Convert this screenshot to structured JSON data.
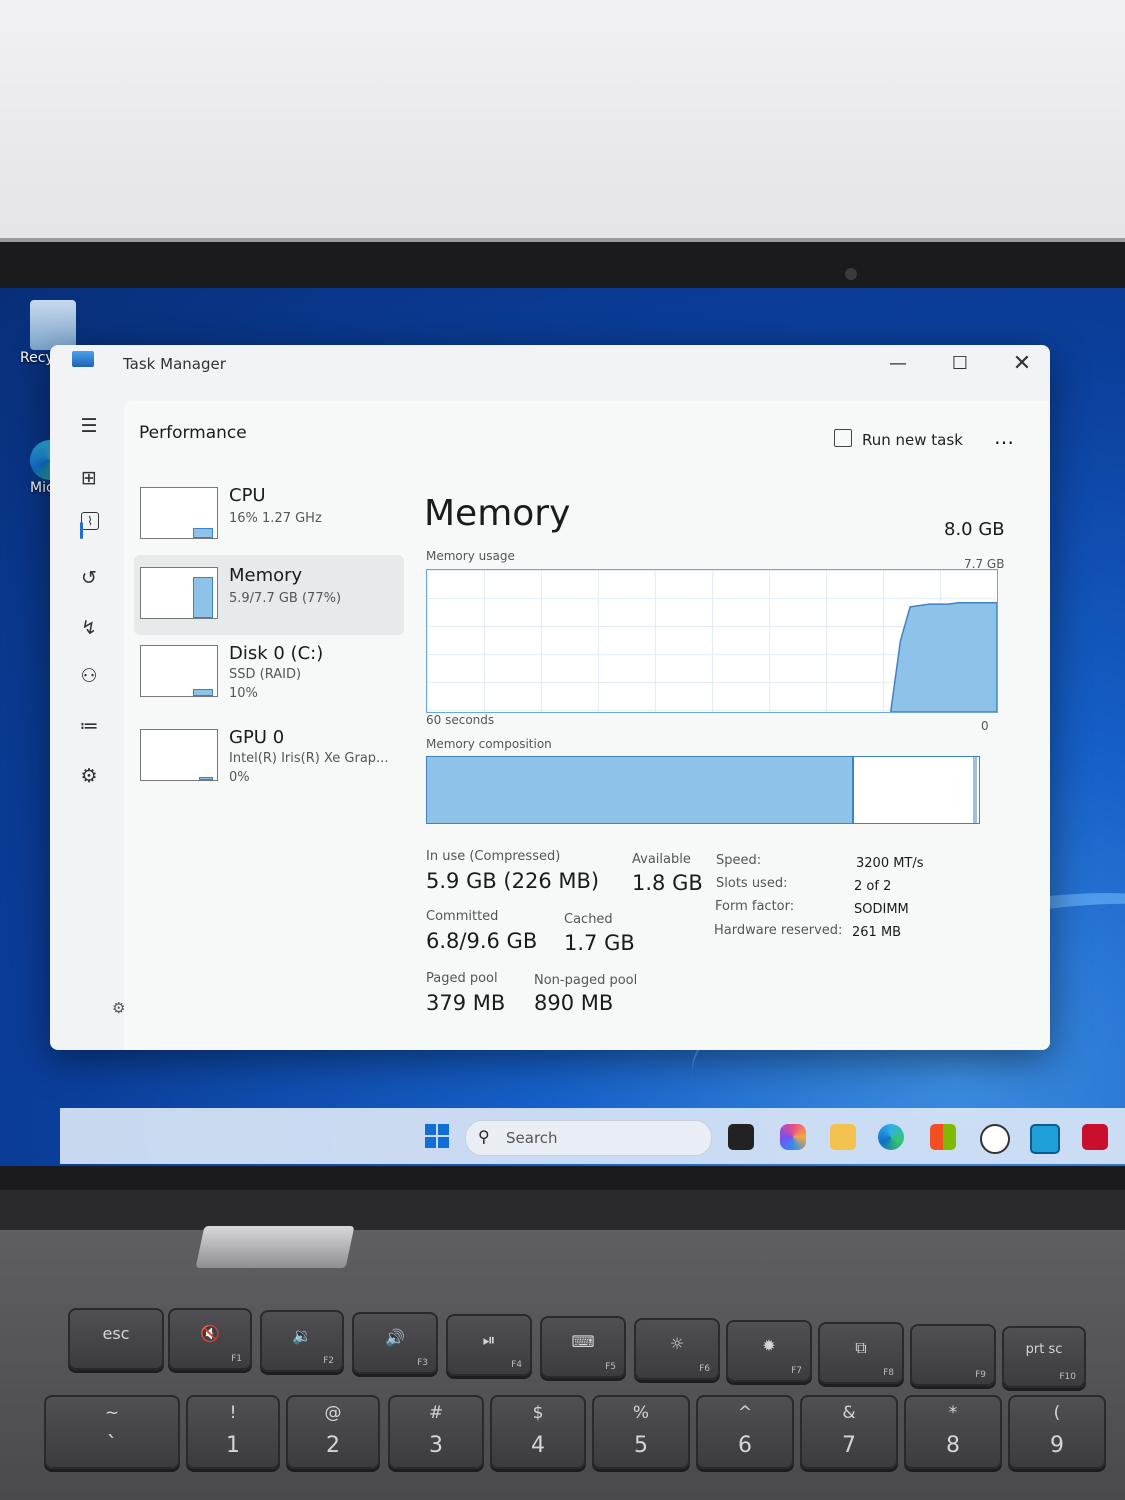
{
  "desktop": {
    "recycle_label": "Recy",
    "edge_label": "Mic E"
  },
  "window": {
    "title": "Task Manager",
    "minimize_glyph": "—",
    "maximize_glyph": "☐",
    "close_glyph": "✕"
  },
  "nav": {
    "menu_glyph": "☰",
    "processes_glyph": "⊞",
    "performance_glyph": "⌇",
    "history_glyph": "↺",
    "startup_glyph": "↯",
    "users_glyph": "⚇",
    "details_glyph": "≔",
    "services_glyph": "⚙",
    "settings_glyph": "⚙"
  },
  "header": {
    "section_title": "Performance",
    "run_new_task": "Run new task",
    "more_glyph": "…"
  },
  "perf_list": [
    {
      "name": "CPU",
      "line1": "16%  1.27 GHz",
      "line2": "",
      "graph_level": 0.16
    },
    {
      "name": "Memory",
      "line1": "5.9/7.7 GB (77%)",
      "line2": "",
      "graph_level": 0.77
    },
    {
      "name": "Disk 0 (C:)",
      "line1": "SSD (RAID)",
      "line2": "10%",
      "graph_level": 0.1
    },
    {
      "name": "GPU 0",
      "line1": "Intel(R) Iris(R) Xe Grap...",
      "line2": "0%",
      "graph_level": 0.0
    }
  ],
  "memory": {
    "heading": "Memory",
    "total": "8.0 GB",
    "usage_label": "Memory usage",
    "usage_max": "7.7 GB",
    "time_span": "60 seconds",
    "usage_min": "0",
    "composition_label": "Memory composition",
    "in_use_fraction": 0.77,
    "usage_history": [
      0,
      0,
      0,
      0,
      0,
      0,
      0,
      0,
      0,
      0,
      0,
      0,
      0,
      0,
      0,
      0,
      0,
      0,
      0,
      0,
      0,
      0,
      0,
      0,
      0,
      0,
      0,
      0,
      0,
      0,
      0,
      0,
      0,
      0,
      0,
      0,
      0,
      0,
      0,
      0,
      0,
      0,
      0,
      0,
      0,
      0,
      0,
      0,
      0,
      0.5,
      0.74,
      0.75,
      0.76,
      0.76,
      0.76,
      0.77,
      0.77,
      0.77,
      0.77,
      0.77
    ],
    "stats": {
      "in_use_label": "In use (Compressed)",
      "in_use_value": "5.9 GB (226 MB)",
      "available_label": "Available",
      "available_value": "1.8 GB",
      "committed_label": "Committed",
      "committed_value": "6.8/9.6 GB",
      "cached_label": "Cached",
      "cached_value": "1.7 GB",
      "paged_label": "Paged pool",
      "paged_value": "379 MB",
      "nonpaged_label": "Non-paged pool",
      "nonpaged_value": "890 MB"
    },
    "specs": [
      {
        "label": "Speed:",
        "value": "3200 MT/s"
      },
      {
        "label": "Slots used:",
        "value": "2 of 2"
      },
      {
        "label": "Form factor:",
        "value": "SODIMM"
      },
      {
        "label": "Hardware reserved:",
        "value": "261 MB"
      }
    ]
  },
  "taskbar": {
    "search_placeholder": "Search",
    "search_glyph": "⚲"
  },
  "keyboard": {
    "fn_row": [
      {
        "main": "esc",
        "fn": ""
      },
      {
        "main": "🔇",
        "fn": "F1"
      },
      {
        "main": "🔉",
        "fn": "F2"
      },
      {
        "main": "🔊",
        "fn": "F3"
      },
      {
        "main": "⏯",
        "fn": "F4"
      },
      {
        "main": "⌨",
        "fn": "F5"
      },
      {
        "main": "☼",
        "fn": "F6"
      },
      {
        "main": "✹",
        "fn": "F7"
      },
      {
        "main": "⧉",
        "fn": "F8"
      },
      {
        "main": "",
        "fn": "F9"
      },
      {
        "main": "prt sc",
        "fn": "F10"
      }
    ],
    "num_row": [
      {
        "top": "~",
        "bottom": "`"
      },
      {
        "top": "!",
        "bottom": "1"
      },
      {
        "top": "@",
        "bottom": "2"
      },
      {
        "top": "#",
        "bottom": "3"
      },
      {
        "top": "$",
        "bottom": "4"
      },
      {
        "top": "%",
        "bottom": "5"
      },
      {
        "top": "^",
        "bottom": "6"
      },
      {
        "top": "&",
        "bottom": "7"
      },
      {
        "top": "*",
        "bottom": "8"
      },
      {
        "top": "(",
        "bottom": "9"
      }
    ]
  },
  "colors": {
    "graph_fill": "#8fc2e8",
    "graph_stroke": "#3d83c2",
    "accent": "#1e6fd0"
  }
}
